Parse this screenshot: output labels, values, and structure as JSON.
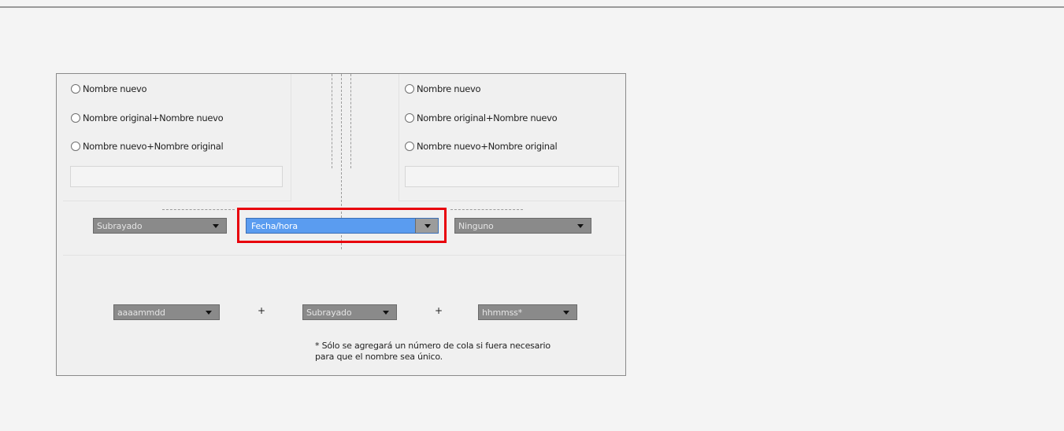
{
  "left_options": [
    "Nombre nuevo",
    "Nombre original+Nombre nuevo",
    "Nombre nuevo+Nombre original"
  ],
  "right_options": [
    "Nombre nuevo",
    "Nombre original+Nombre nuevo",
    "Nombre nuevo+Nombre original"
  ],
  "separators": {
    "left": "Subrayado",
    "middle": "Fecha/hora",
    "right": "Ninguno"
  },
  "format": {
    "date": "aaaammdd",
    "plus": "+",
    "separator": "Subrayado",
    "time": "hhmmss*"
  },
  "note": {
    "line1": "* Sólo se agregará un número de cola si fuera necesario",
    "line2": "para que el nombre sea único."
  },
  "colors": {
    "highlight": "#e8000b",
    "selected": "#5a9cf0"
  }
}
